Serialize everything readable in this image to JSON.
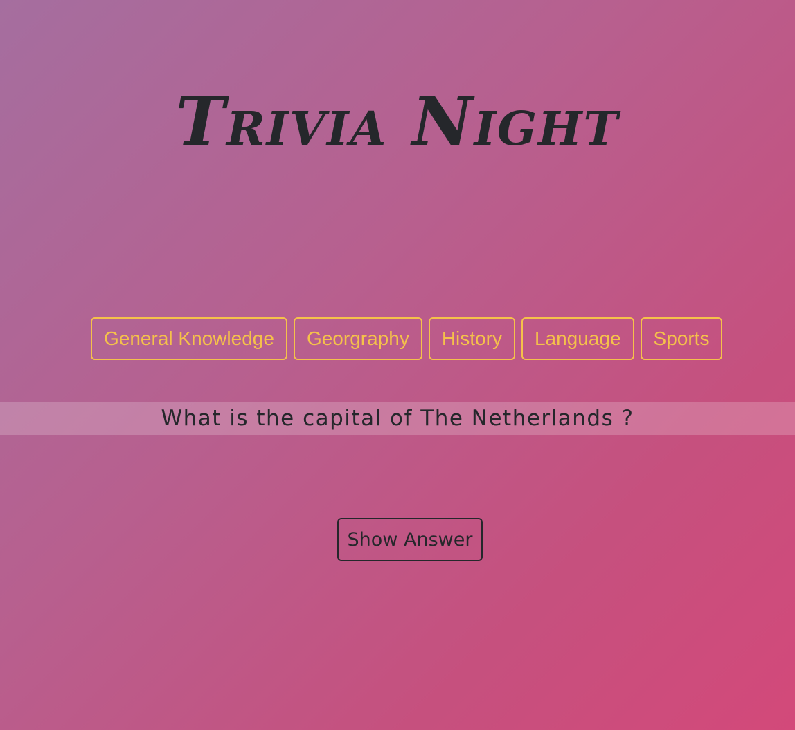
{
  "app": {
    "title": "Trivia Night"
  },
  "categories": [
    {
      "label": "General Knowledge"
    },
    {
      "label": "Georgraphy"
    },
    {
      "label": "History"
    },
    {
      "label": "Language"
    },
    {
      "label": "Sports"
    }
  ],
  "question": {
    "text": "What is the capital of The Netherlands ?"
  },
  "actions": {
    "show_answer_label": "Show Answer"
  },
  "colors": {
    "accent": "#f5c14a",
    "text": "#25272b",
    "gradient_start": "#a56e9f",
    "gradient_end": "#d3497a"
  }
}
